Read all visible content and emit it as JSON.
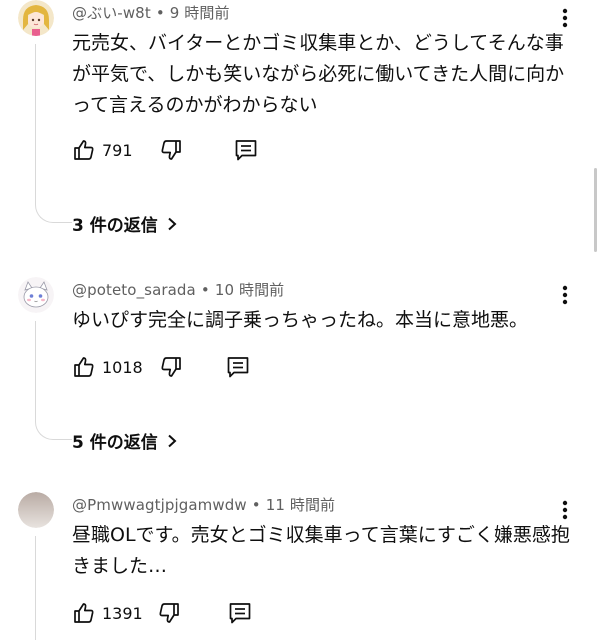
{
  "comments": [
    {
      "username": "@ぶい-w8t",
      "separator": "•",
      "time": "9 時間前",
      "text": "元売女、バイターとかゴミ収集車とか、どうしてそんな事が平気で、しかも笑いながら必死に働いてきた人間に向かって言えるのかがわからない",
      "likes": "791",
      "replies_label": "3 件の返信",
      "avatar_icon": "anime-girl-avatar"
    },
    {
      "username": "@poteto_sarada",
      "separator": "•",
      "time": "10 時間前",
      "text": "ゆいぴす完全に調子乗っちゃったね。本当に意地悪。",
      "likes": "1018",
      "replies_label": "5 件の返信",
      "avatar_icon": "cat-avatar"
    },
    {
      "username": "@Pmwwagtjpjgamwdw",
      "separator": "•",
      "time": "11 時間前",
      "text": "昼職OLです。売女とゴミ収集車って言葉にすごく嫌悪感抱きました…",
      "likes": "1391",
      "avatar_icon": "photo-avatar"
    }
  ],
  "icons": {
    "like": "thumbs-up-icon",
    "dislike": "thumbs-down-icon",
    "reply": "reply-comment-icon",
    "menu": "more-vert-icon",
    "chevron": "chevron-right-icon"
  },
  "colors": {
    "meta_text": "#606060",
    "body_text": "#0f0f0f",
    "thread_line": "#d9d9d9"
  }
}
